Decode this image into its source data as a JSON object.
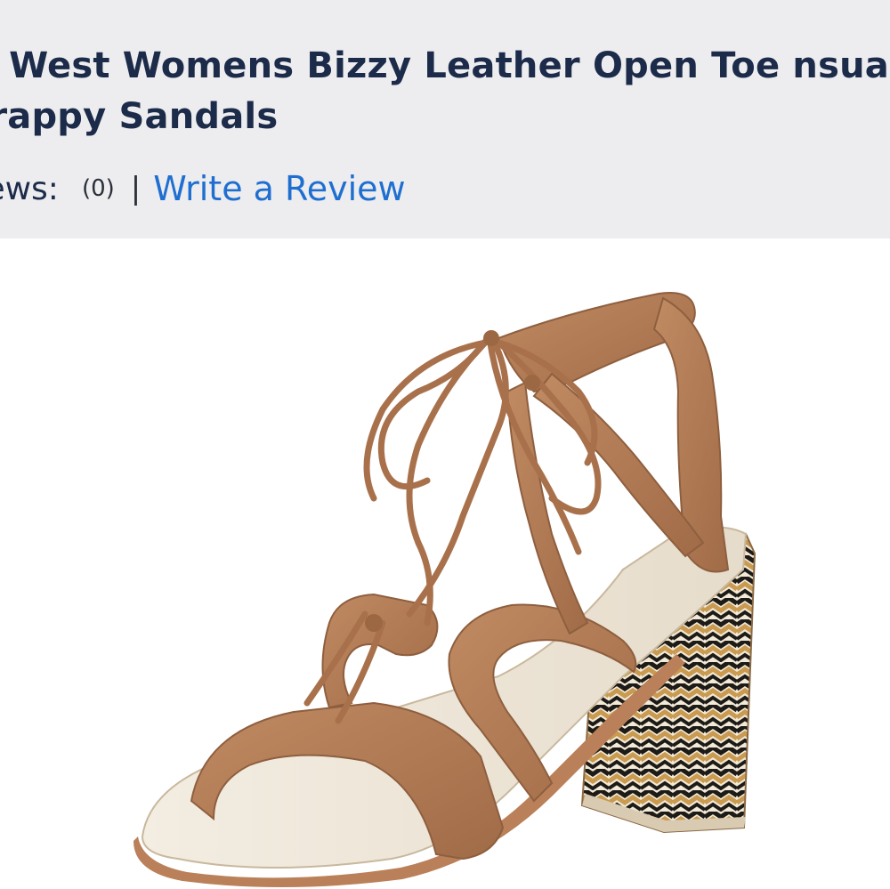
{
  "product": {
    "title": "ne West Womens Bizzy Leather Open Toe nsual Strappy Sandals",
    "image_alt": "product-photo"
  },
  "reviews": {
    "label": "eviews:",
    "count": "(0)",
    "separator": "|",
    "write_link": "Write a Review"
  },
  "colors": {
    "header_bg": "#ededf0",
    "title": "#1c2b49",
    "link": "#1f6fd0",
    "suede": "#b07a55"
  }
}
